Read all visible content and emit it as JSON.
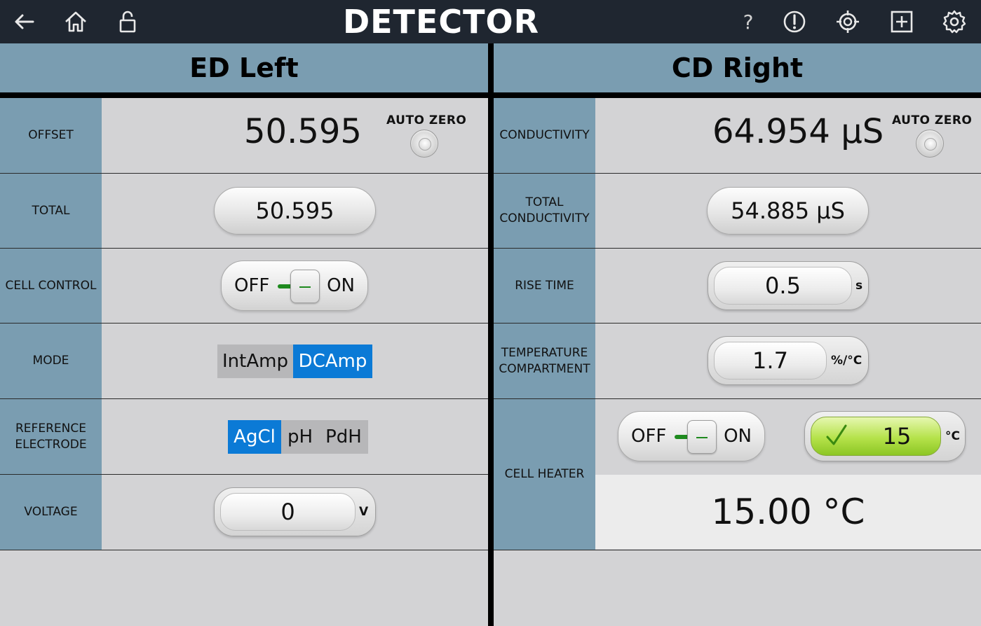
{
  "app": {
    "title": "DETECTOR",
    "nav_icons": [
      "back-arrow-icon",
      "home-icon",
      "unlock-icon"
    ],
    "action_icons": [
      "help-icon",
      "alert-icon",
      "target-icon",
      "add-icon",
      "settings-icon"
    ],
    "help_glyph": "?"
  },
  "left_panel": {
    "header": "ED Left",
    "offset": {
      "label": "OFFSET",
      "value": "50.595",
      "auto_zero_label": "AUTO ZERO"
    },
    "total": {
      "label": "TOTAL",
      "value": "50.595"
    },
    "cell_control": {
      "label": "CELL CONTROL",
      "off_label": "OFF",
      "on_label": "ON"
    },
    "mode": {
      "label": "MODE",
      "options": [
        "IntAmp",
        "DCAmp"
      ],
      "selected": "DCAmp"
    },
    "reference_electrode": {
      "label_line1": "REFERENCE",
      "label_line2": "ELECTRODE",
      "options": [
        "AgCl",
        "pH",
        "PdH"
      ],
      "selected": "AgCl"
    },
    "voltage": {
      "label": "VOLTAGE",
      "value": "0",
      "unit": "V"
    }
  },
  "right_panel": {
    "header": "CD Right",
    "conductivity": {
      "label": "CONDUCTIVITY",
      "value": "64.954 µS",
      "auto_zero_label": "AUTO ZERO"
    },
    "total_conductivity": {
      "label_line1": "TOTAL",
      "label_line2": "CONDUCTIVITY",
      "value": "54.885 µS"
    },
    "rise_time": {
      "label": "RISE TIME",
      "value": "0.5",
      "unit": "s"
    },
    "temperature_compartment": {
      "label_line1": "TEMPERATURE",
      "label_line2": "COMPARTMENT",
      "value": "1.7",
      "unit": "%/°C"
    },
    "cell_heater": {
      "label": "CELL HEATER",
      "off_label": "OFF",
      "on_label": "ON",
      "setpoint": "15",
      "setpoint_unit": "°C",
      "reading": "15.00 °C"
    }
  },
  "colors": {
    "topbar": "#1f2630",
    "label_column": "#7a9db1",
    "panel_bg": "#d3d3d5",
    "selected_segment": "#0b7ad6",
    "toggle_indicator": "#1e8a1e",
    "setpoint_ok": "#a6d83a"
  }
}
